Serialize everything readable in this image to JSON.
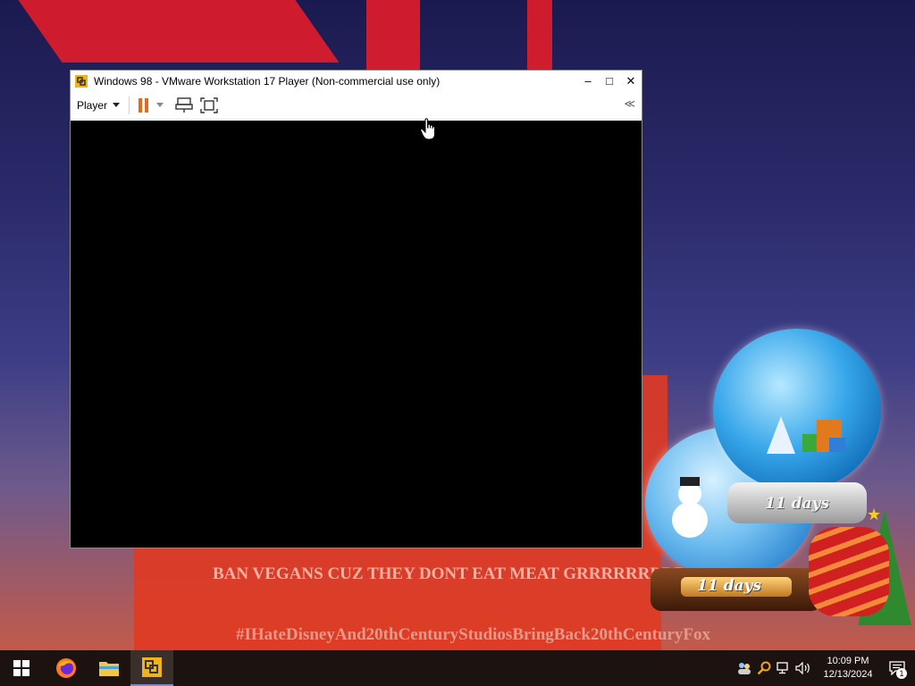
{
  "desktop": {
    "wallpaper_text_1": "BAN VEGANS CUZ THEY DONT EAT MEAT GRRRRRRRRRRR",
    "wallpaper_text_2": "#IHateDisneyAnd20thCenturyStudiosBringBack20thCenturyFox",
    "countdown_top": "11 days",
    "countdown_bottom": "11 days"
  },
  "vm_window": {
    "title": "Windows 98 - VMware Workstation 17 Player (Non-commercial use only)",
    "minimize": "–",
    "maximize": "□",
    "close": "✕",
    "player_menu": "Player",
    "collapse": "≪"
  },
  "taskbar": {
    "items": [
      {
        "name": "start-button",
        "icon": "windows-logo-icon"
      },
      {
        "name": "firefox",
        "icon": "firefox-icon"
      },
      {
        "name": "file-explorer",
        "icon": "folder-icon"
      },
      {
        "name": "vmware-player",
        "icon": "vmware-icon",
        "active": true
      }
    ],
    "clock_time": "10:09 PM",
    "clock_date": "12/13/2024",
    "notification_count": "1"
  },
  "colors": {
    "pause_orange": "#e36a1e",
    "taskbar_bg": "#1c1310",
    "vm_screen": "#000000"
  }
}
